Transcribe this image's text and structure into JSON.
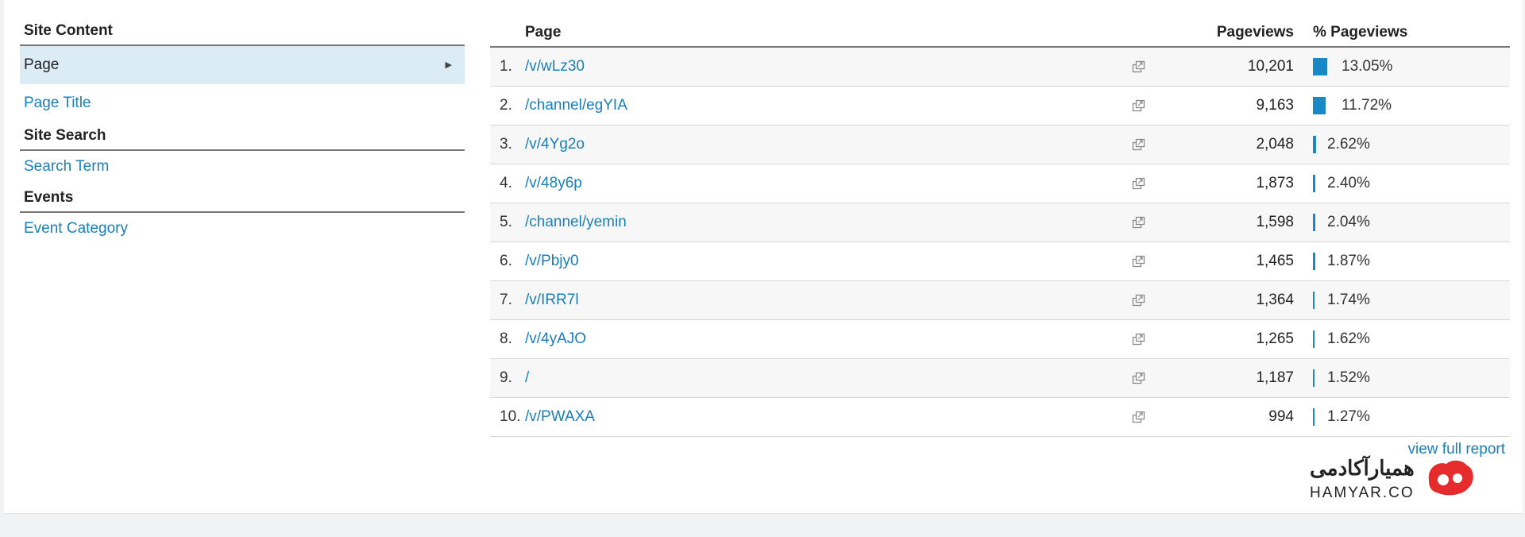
{
  "nav": {
    "sections": [
      {
        "title": "Site Content",
        "items": [
          {
            "label": "Page",
            "selected": true
          },
          {
            "label": "Page Title",
            "selected": false
          }
        ]
      },
      {
        "title": "Site Search",
        "items": [
          {
            "label": "Search Term",
            "selected": false
          }
        ]
      },
      {
        "title": "Events",
        "items": [
          {
            "label": "Event Category",
            "selected": false
          }
        ]
      }
    ]
  },
  "table": {
    "headers": {
      "page": "Page",
      "pageviews": "Pageviews",
      "pct": "% Pageviews"
    },
    "rows": [
      {
        "num": "1.",
        "path": "/v/wLz30",
        "pageviews": "10,201",
        "pct": "13.05%",
        "pct_value": 13.05
      },
      {
        "num": "2.",
        "path": "/channel/egYIA",
        "pageviews": "9,163",
        "pct": "11.72%",
        "pct_value": 11.72
      },
      {
        "num": "3.",
        "path": "/v/4Yg2o",
        "pageviews": "2,048",
        "pct": "2.62%",
        "pct_value": 2.62
      },
      {
        "num": "4.",
        "path": "/v/48y6p",
        "pageviews": "1,873",
        "pct": "2.40%",
        "pct_value": 2.4
      },
      {
        "num": "5.",
        "path": "/channel/yemin",
        "pageviews": "1,598",
        "pct": "2.04%",
        "pct_value": 2.04
      },
      {
        "num": "6.",
        "path": "/v/Pbjy0",
        "pageviews": "1,465",
        "pct": "1.87%",
        "pct_value": 1.87
      },
      {
        "num": "7.",
        "path": "/v/IRR7l",
        "pageviews": "1,364",
        "pct": "1.74%",
        "pct_value": 1.74
      },
      {
        "num": "8.",
        "path": "/v/4yAJO",
        "pageviews": "1,265",
        "pct": "1.62%",
        "pct_value": 1.62
      },
      {
        "num": "9.",
        "path": "/",
        "pageviews": "1,187",
        "pct": "1.52%",
        "pct_value": 1.52
      },
      {
        "num": "10.",
        "path": "/v/PWAXA",
        "pageviews": "994",
        "pct": "1.27%",
        "pct_value": 1.27
      }
    ],
    "view_full_report": "view full report"
  },
  "watermark": {
    "fa_text": "همیارآکادمی",
    "en_text": "HAMYAR.CO",
    "brand_color": "#e52b2b"
  },
  "colors": {
    "link": "#1a7fb8",
    "bar": "#1a87c6",
    "selected_bg": "#dcecf6"
  }
}
